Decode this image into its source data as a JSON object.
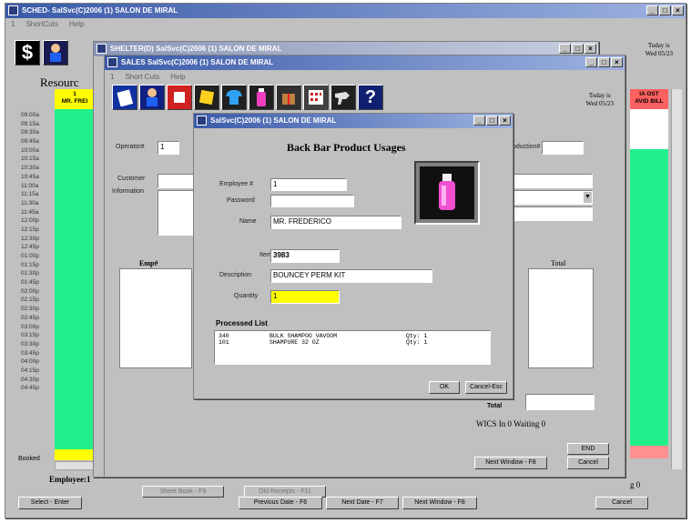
{
  "sched": {
    "title": "SCHED- SalSvc(C)2006 (1) SALON DE MIRAL",
    "menu": [
      "1",
      "ShortCuts",
      "Help"
    ],
    "today_label": "Today is",
    "today_value": "Wed 05/23",
    "resource_label": "Resourc",
    "column_header": "1\nMR. FREI",
    "col2_header": "IA OST\nAVID BILL",
    "times": [
      "09:00a",
      "09:15a",
      "09:30a",
      "09:45a",
      "10:00a",
      "10:15a",
      "10:30a",
      "10:45a",
      "11:00a",
      "11:15a",
      "11:30a",
      "11:45a",
      "12:00p",
      "12:15p",
      "12:30p",
      "12:45p",
      "01:00p",
      "01:15p",
      "01:30p",
      "01:45p",
      "02:00p",
      "02:15p",
      "02:30p",
      "02:45p",
      "03:00p",
      "03:15p",
      "03:30p",
      "03:45p",
      "04:00p",
      "04:15p",
      "04:30p",
      "04:45p"
    ],
    "booked_label": "Booked",
    "employee_label": "Employee:1",
    "bottom_buttons": {
      "select": "Select - Enter",
      "previous_date": "Previous Date - F6",
      "next_date": "Next Date - F7",
      "next_window": "Next Window - F8",
      "cancel": "Cancel"
    },
    "hidden_buttons": {
      "sheet_book": "Sheet Book - F9",
      "old_receipts": "Old Receipts - F11"
    },
    "right_g": "g 0"
  },
  "shelter": {
    "title": "SHELTER(D) SalSvc(C)2006 (1) SALON DE MIRAL"
  },
  "sales": {
    "title": "SALES SalSvc(C)2006 (1) SALON DE MIRAL",
    "menu": [
      "1",
      "Short Cuts",
      "Help"
    ],
    "today_label": "Today is",
    "today_value": "Wed 05/23",
    "operator_label": "Operator#",
    "operator_value": "1",
    "customer_label": "Customer",
    "information_label": "Information",
    "production_label": "oduction#",
    "emp_col": "Emp#",
    "total_col": "Total",
    "total_label": "Total",
    "wics": "WICS In 0 Waiting 0",
    "next_window": "Next Window - F8",
    "end": "END",
    "cancel": "Cancel"
  },
  "dialog": {
    "title": "SalSvc(C)2006 (1) SALON DE MIRAL",
    "heading": "Back Bar Product Usages",
    "employee_label": "Employee #",
    "employee_value": "1",
    "password_label": "Password",
    "password_value": "",
    "name_label": "Name",
    "name_value": "MR. FREDERICO",
    "item_label": "Item",
    "item_value": "3983",
    "description_label": "Description",
    "description_value": "BOUNCEY PERM KIT",
    "quantity_label": "Quantity",
    "quantity_value": "1",
    "processed_label": "Processed List",
    "processed": [
      {
        "code": "340",
        "name": "BULK SHAMPOO VAVOOM",
        "qty": "Qty:  1"
      },
      {
        "code": "101",
        "name": "SHAMPURE 32 OZ",
        "qty": "Qty:  1"
      }
    ],
    "ok": "OK",
    "cancel_esc": "Cancel-Esc"
  },
  "colors": {
    "schedule_green": "#22f08c",
    "schedule_yellow": "#ffff00",
    "header_red": "#ff6060",
    "quantity_yellow": "#ffff00",
    "titlebar_blue": "#3a5aa8"
  }
}
